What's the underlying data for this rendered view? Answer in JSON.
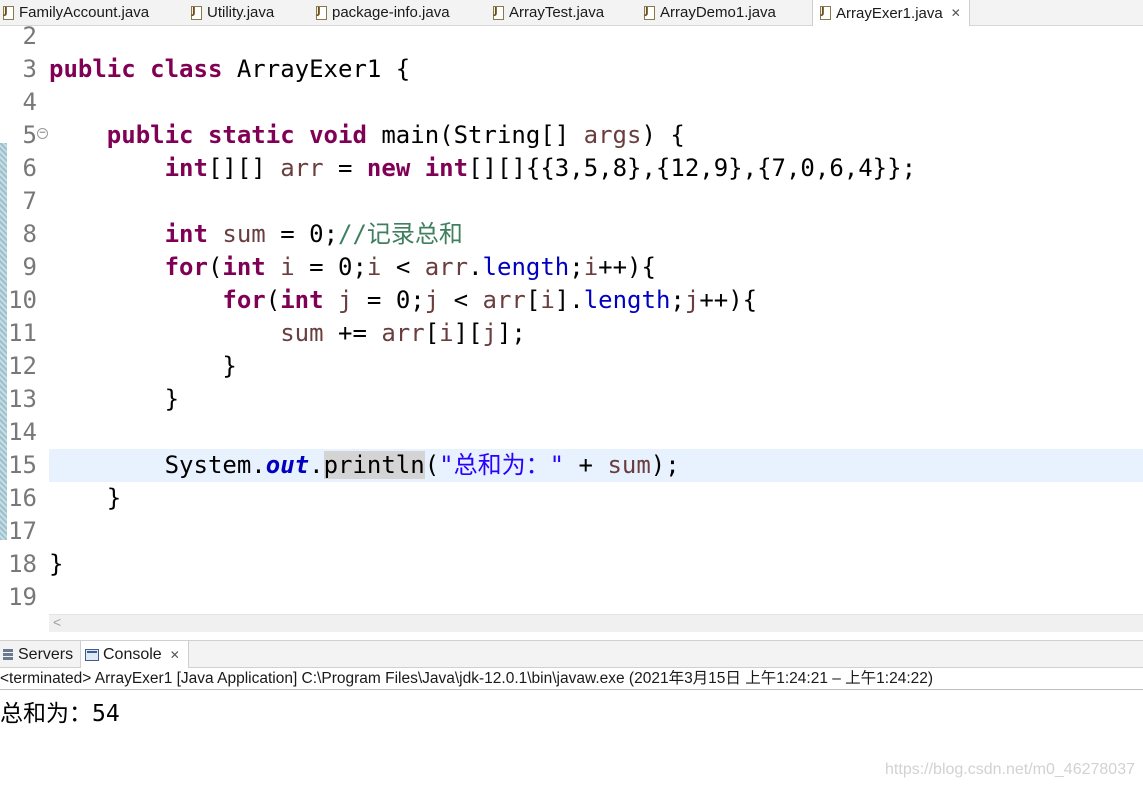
{
  "editor_tabs": [
    {
      "label": "FamilyAccount.java",
      "active": false
    },
    {
      "label": "Utility.java",
      "active": false
    },
    {
      "label": "package-info.java",
      "active": false
    },
    {
      "label": "ArrayTest.java",
      "active": false
    },
    {
      "label": "ArrayDemo1.java",
      "active": false
    },
    {
      "label": "ArrayExer1.java",
      "active": true,
      "close_glyph": "✕"
    }
  ],
  "code": {
    "lines": [
      {
        "num": "2"
      },
      {
        "num": "3"
      },
      {
        "num": "4"
      },
      {
        "num": "5",
        "fold_glyph": "⊖"
      },
      {
        "num": "6"
      },
      {
        "num": "7"
      },
      {
        "num": "8"
      },
      {
        "num": "9"
      },
      {
        "num": "10"
      },
      {
        "num": "11"
      },
      {
        "num": "12"
      },
      {
        "num": "13"
      },
      {
        "num": "14"
      },
      {
        "num": "15",
        "current": true
      },
      {
        "num": "16"
      },
      {
        "num": "17"
      },
      {
        "num": "18"
      },
      {
        "num": "19"
      }
    ],
    "t": {
      "public": "public",
      "class": "class",
      "static": "static",
      "void": "void",
      "int": "int",
      "new": "new",
      "for": "for",
      "classname": " ArrayExer1 {",
      "main_sig": " main(String[] ",
      "args": "args",
      "main_end": ") {",
      "int_arr_decl": "[][] ",
      "arr": "arr",
      "eq": " = ",
      "arr_init": "[][]{{3,5,8},{12,9},{7,0,6,4}};",
      "sum": "sum",
      "sum_init": " = 0;",
      "sum_comment": "//记录总和",
      "lparen": "(",
      "i": "i",
      "j": "j",
      "i_init": " = 0;",
      "lt": " < ",
      "dot": ".",
      "length": "length",
      "semi": ";",
      "inc_i_end": "++){",
      "idx_i": "[",
      "idx_close": "]",
      "sum_plus": " += ",
      "idx_ij_mid": "][",
      "idx_ij_end": "];",
      "close_brace": "}",
      "system": "System.",
      "out": "out",
      "println": "println",
      "str": "\"总和为：\"",
      "plus": " + ",
      "call_end": ");"
    }
  },
  "scroll": {
    "left_arrow": "<"
  },
  "panel_tabs": [
    {
      "label": "Servers",
      "active": false
    },
    {
      "label": "Console",
      "active": true,
      "close_glyph": "✕"
    }
  ],
  "console": {
    "status": "<terminated> ArrayExer1 [Java Application] C:\\Program Files\\Java\\jdk-12.0.1\\bin\\javaw.exe  (2021年3月15日 上午1:24:21 – 上午1:24:22)",
    "output": "总和为：54"
  },
  "watermark": "https://blog.csdn.net/m0_46278037",
  "icons": {
    "java_file": "java-file-icon",
    "servers": "servers-icon",
    "console": "console-icon"
  }
}
